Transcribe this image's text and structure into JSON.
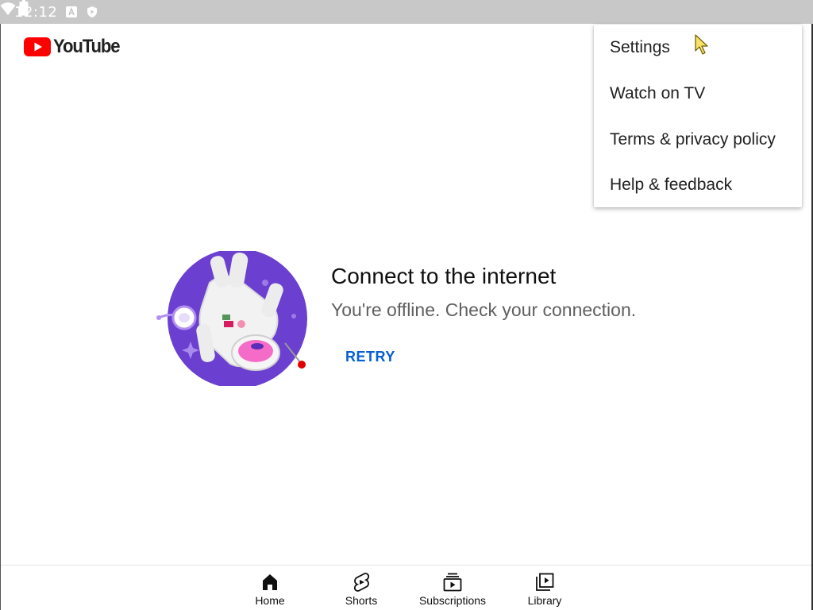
{
  "status_bar": {
    "time": "12:12",
    "icons": [
      "notification-a-icon",
      "notification-shield-icon",
      "wifi-icon",
      "battery-icon"
    ],
    "background_color": "#c8c8c8"
  },
  "app_bar": {
    "logo_text": "YouTube",
    "brand_color": "#ff0000"
  },
  "overflow_menu": {
    "items": [
      {
        "label": "Settings"
      },
      {
        "label": "Watch on TV"
      },
      {
        "label": "Terms & privacy policy"
      },
      {
        "label": "Help & feedback"
      }
    ]
  },
  "offline": {
    "title": "Connect to the internet",
    "message": "You're offline. Check your connection.",
    "retry_label": "RETRY",
    "accent_color": "#065fd4",
    "illustration": "astronaut-offline-illustration"
  },
  "bottom_nav": {
    "tabs": [
      {
        "label": "Home",
        "icon": "home-icon",
        "selected": true
      },
      {
        "label": "Shorts",
        "icon": "shorts-icon",
        "selected": false
      },
      {
        "label": "Subscriptions",
        "icon": "subscriptions-icon",
        "selected": false
      },
      {
        "label": "Library",
        "icon": "library-icon",
        "selected": false
      }
    ]
  }
}
